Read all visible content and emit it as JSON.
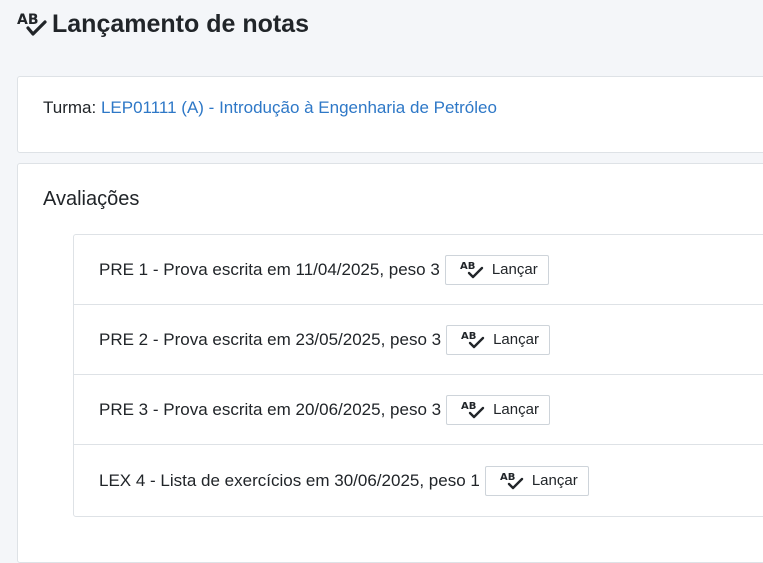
{
  "header": {
    "title": "Lançamento de notas",
    "icon": "spellcheck-icon"
  },
  "turma": {
    "label": "Turma:",
    "link_text": "LEP01111 (A) - Introdução à Engenharia de Petróleo"
  },
  "avaliacoes": {
    "title": "Avaliações",
    "button_label": "Lançar",
    "button_icon": "spellcheck-icon",
    "items": [
      {
        "text": "PRE 1 - Prova escrita em 11/04/2025, peso 3"
      },
      {
        "text": "PRE 2 - Prova escrita em 23/05/2025, peso 3"
      },
      {
        "text": "PRE 3 - Prova escrita em 20/06/2025, peso 3"
      },
      {
        "text": "LEX 4 - Lista de exercícios em 30/06/2025, peso 1"
      }
    ]
  },
  "colors": {
    "link": "#2e78c7",
    "background": "#f4f6f9",
    "border": "#dee2e6"
  }
}
